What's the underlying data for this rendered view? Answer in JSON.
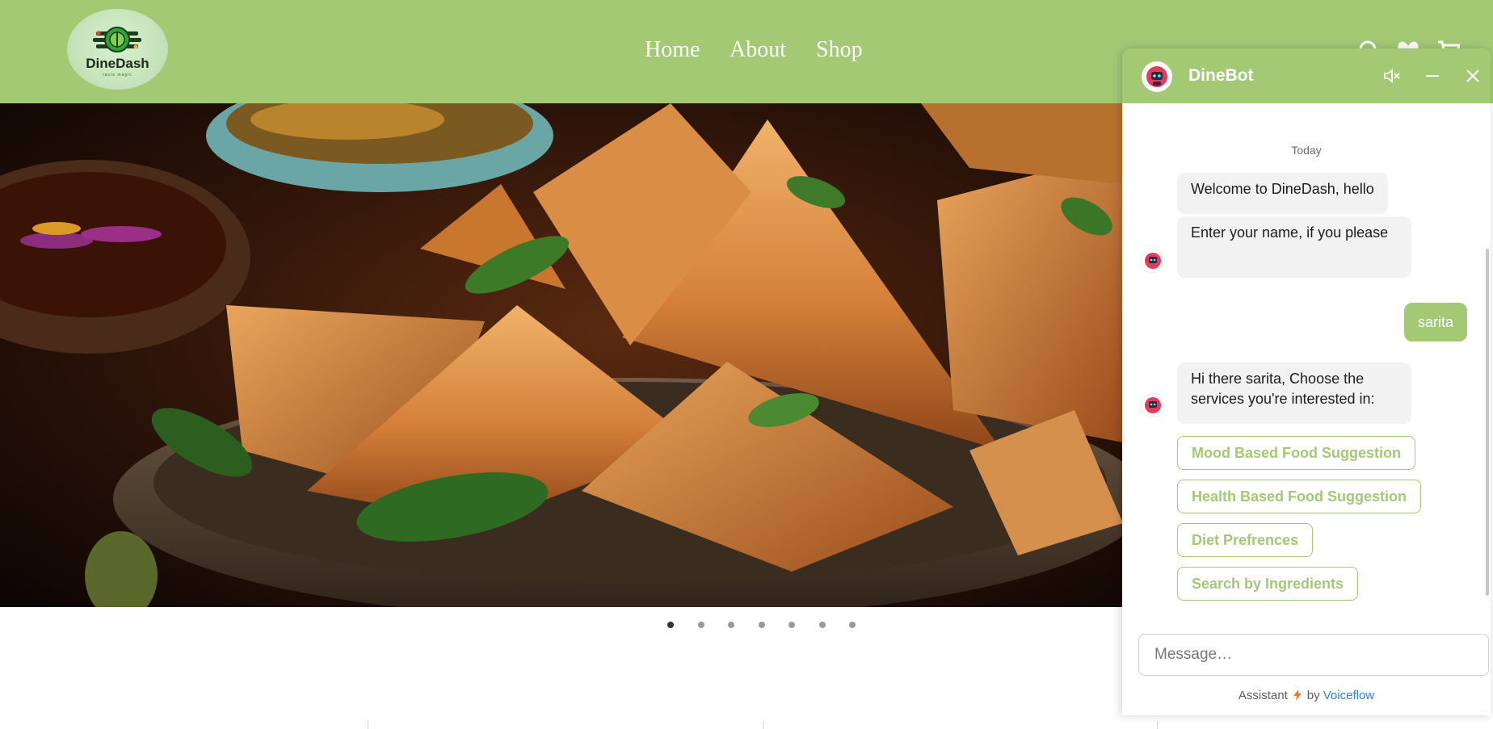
{
  "header": {
    "logo_text": "DineDash",
    "logo_tagline": "taste magic",
    "nav": [
      {
        "label": "Home"
      },
      {
        "label": "About"
      },
      {
        "label": "Shop"
      }
    ],
    "icons": [
      "search-icon",
      "heart-icon",
      "cart-icon"
    ]
  },
  "hero": {
    "carousel_dot_count": 7,
    "active_dot": 1
  },
  "chat": {
    "title": "DineBot",
    "controls": [
      "mute-icon",
      "minimize-icon",
      "close-icon"
    ],
    "date_divider": "Today",
    "messages": [
      {
        "from": "bot",
        "text": "Welcome to DineDash, hello"
      },
      {
        "from": "bot",
        "text": "Enter your name, if you please"
      },
      {
        "from": "user",
        "text": "sarita"
      },
      {
        "from": "bot",
        "text": "Hi there sarita, Choose the services you're interested in:"
      }
    ],
    "choices": [
      {
        "label": "Mood Based Food Suggestion"
      },
      {
        "label": "Health Based Food Suggestion"
      },
      {
        "label": "Diet Prefrences"
      },
      {
        "label": "Search by Ingredients"
      }
    ],
    "input_placeholder": "Message…",
    "footer": {
      "prefix": "Assistant",
      "by": "by",
      "brand": "Voiceflow"
    }
  },
  "colors": {
    "brand_green": "#a3c975",
    "link_blue": "#2f7fd8",
    "bubble_gray": "#f2f2f2"
  }
}
